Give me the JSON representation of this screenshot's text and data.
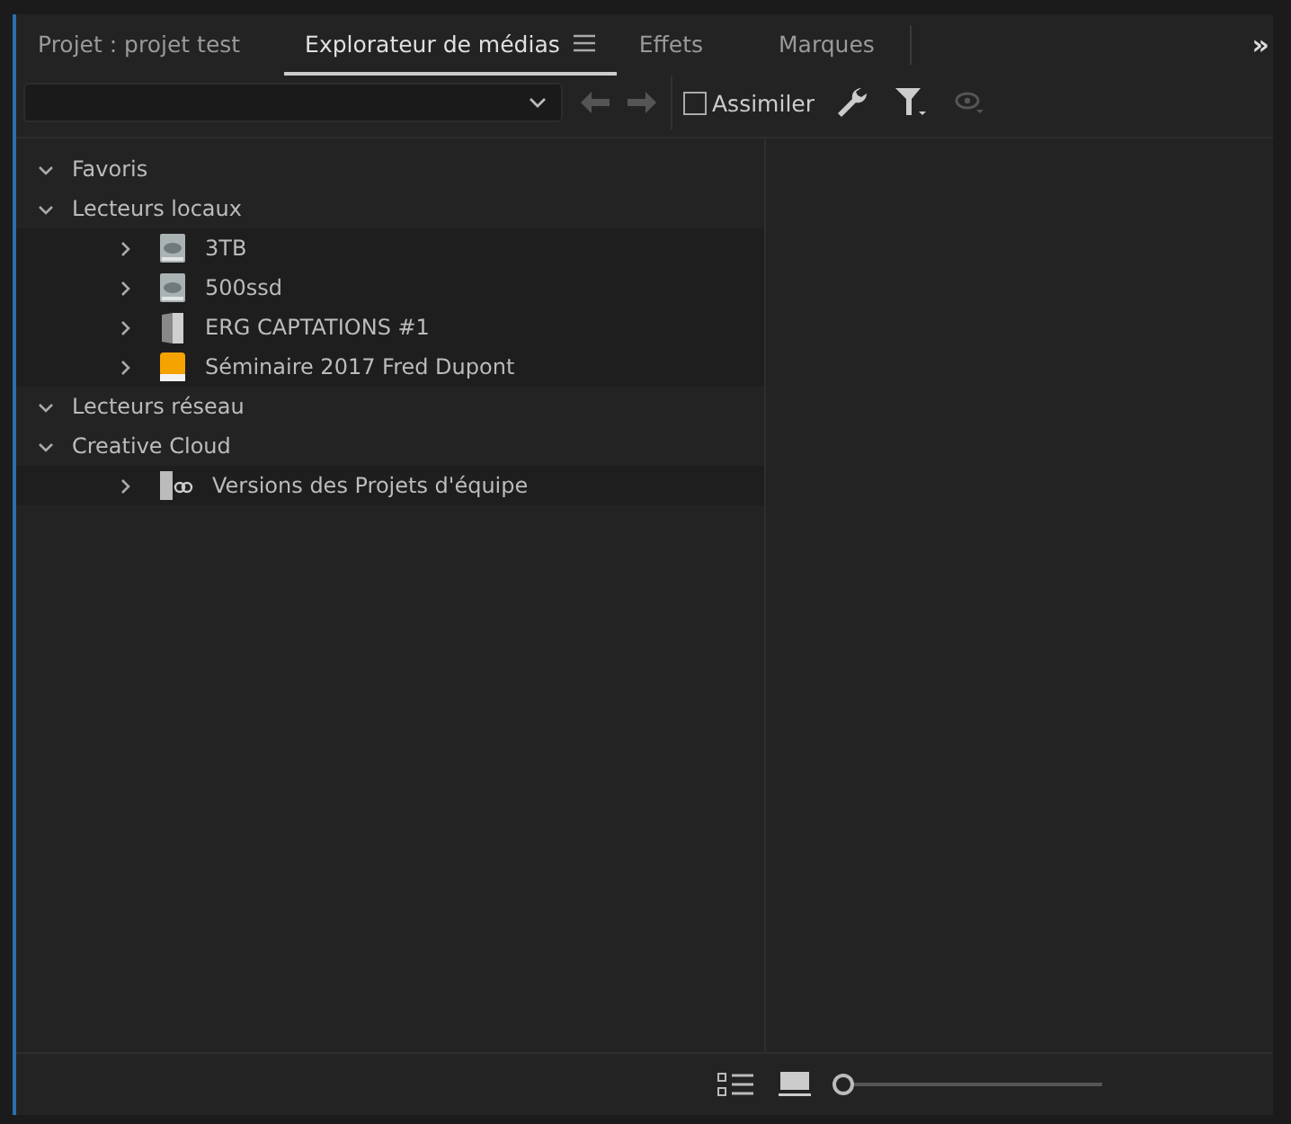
{
  "tabs": [
    {
      "label": "Projet : projet test",
      "selected": false
    },
    {
      "label": "Explorateur de médias",
      "selected": true,
      "menu": true
    },
    {
      "label": "Effets",
      "selected": false
    },
    {
      "label": "Marques",
      "selected": false
    }
  ],
  "overflow": "»",
  "toolbar": {
    "ingest": {
      "label": "Assimiler",
      "checked": false
    }
  },
  "tree": [
    {
      "label": "Favoris",
      "expanded": true
    },
    {
      "label": "Lecteurs locaux",
      "expanded": true,
      "children": [
        {
          "label": "3TB",
          "kind": "disk",
          "expanded": false
        },
        {
          "label": "500ssd",
          "kind": "disk",
          "expanded": false
        },
        {
          "label": "ERG CAPTATIONS #1",
          "kind": "server",
          "expanded": false
        },
        {
          "label": "Séminaire 2017 Fred Dupont",
          "kind": "usb",
          "expanded": false
        }
      ]
    },
    {
      "label": "Lecteurs réseau",
      "expanded": true
    },
    {
      "label": "Creative Cloud",
      "expanded": true,
      "children": [
        {
          "label": "Versions des Projets d'équipe",
          "kind": "team",
          "expanded": false
        }
      ]
    }
  ],
  "zoom": {
    "level": 0.0
  }
}
